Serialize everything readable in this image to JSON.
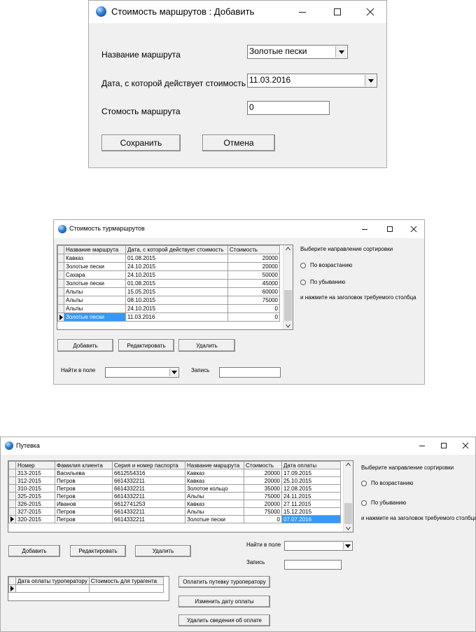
{
  "w1": {
    "title": "Стоимость маршрутов : Добавить",
    "route_label": "Название маршрута",
    "route_value": "Золотые пески",
    "date_label": "Дата, с которой действует стоимость",
    "date_value": "11.03.2016",
    "cost_label": "Стомость маршрута",
    "cost_value": "0",
    "save_label": "Сохранить",
    "cancel_label": "Отмена"
  },
  "w2": {
    "title": "Стоимость турмаршрутов",
    "columns": [
      "Название маршрута",
      "Дата, с которой действует стоимость",
      "Стоимость"
    ],
    "rows": [
      [
        "Кавказ",
        "01.08.2015",
        "20000"
      ],
      [
        "Золотые пески",
        "24.10.2015",
        "20000"
      ],
      [
        "Сахара",
        "24.10.2015",
        "50000"
      ],
      [
        "Золотые пески",
        "01.08.2015",
        "45000"
      ],
      [
        "Альпы",
        "15.05.2015",
        "60000"
      ],
      [
        "Альпы",
        "08.10.2015",
        "75000"
      ],
      [
        "Альпы",
        "24.10.2015",
        "0"
      ],
      [
        "Золотые пески",
        "11.03.2016",
        "0"
      ]
    ],
    "sort_title": "Выберите направление сортировки",
    "asc_label": "По возрастанию",
    "desc_label": "По убыванию",
    "sort_hint": "и нажмите на заголовок требуемого столбца",
    "add_label": "Добавить",
    "edit_label": "Редактировать",
    "delete_label": "Удалить",
    "find_label": "Найти в поле",
    "record_label": "Запись"
  },
  "w3": {
    "title": "Путевка",
    "columns": [
      "Номер",
      "Фамилия клиента",
      "Серия и номер паспорта",
      "Название маршрута",
      "Стоимость",
      "Дата оплаты"
    ],
    "rows": [
      [
        "313-2015",
        "Васильева",
        "6612554316",
        "Кавказ",
        "20000",
        "17.09.2015"
      ],
      [
        "312-2015",
        "Петров",
        "6614332211",
        "Кавказ",
        "20000",
        "25.10.2015"
      ],
      [
        "310-2015",
        "Петров",
        "6614332211",
        "Золотое кольцо",
        "35000",
        "12.08.2015"
      ],
      [
        "325-2015",
        "Петров",
        "6614332211",
        "Альпы",
        "75000",
        "24.11.2015"
      ],
      [
        "326-2015",
        "Иванов",
        "6612741253",
        "Кавказ",
        "20000",
        "27.11.2015"
      ],
      [
        "327-2015",
        "Петров",
        "6614332211",
        "Альпы",
        "75000",
        "15.12.2015"
      ],
      [
        "320-2015",
        "Петров",
        "6614332211",
        "Золотые пески",
        "0",
        "07.07.2016"
      ]
    ],
    "sort_title": "Выберите направление сортировки",
    "asc_label": "По возрастанию",
    "desc_label": "По убыванию",
    "sort_hint": "и нажмите на заголовок требуемого столбца",
    "add_label": "Добавить",
    "edit_label": "Редактировать",
    "delete_label": "Удалить",
    "find_label": "Найти в поле",
    "record_label": "Запись",
    "pay_columns": [
      "Дата оплаты туроператору",
      "Стоимость для турагента"
    ],
    "pay_btn_label": "Оплатить путевку туроператору",
    "change_date_label": "Изменить дату оплаты",
    "delete_pay_label": "Удалить сведения об оплате"
  }
}
